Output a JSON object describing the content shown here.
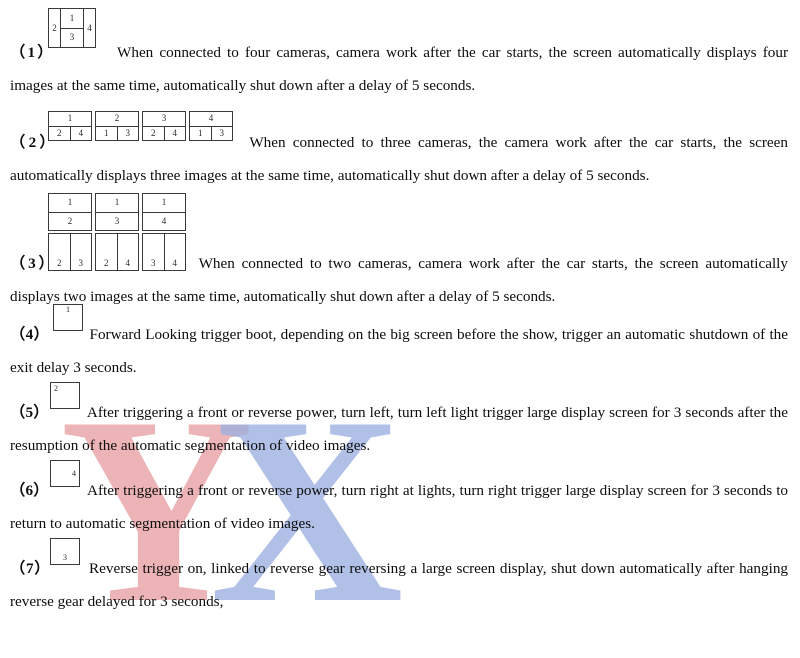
{
  "document": {
    "type": "manual-page",
    "watermark": {
      "letters": [
        "Y",
        "X"
      ],
      "colors": [
        "#e8a0a4",
        "#9cafe0"
      ]
    }
  },
  "items": [
    {
      "marker": "（1）",
      "text": "When connected to four cameras, camera work after the car starts, the screen automatically displays four images at the same time, automatically shut down after a delay of 5 seconds.",
      "diagram": {
        "kind": "quad-split",
        "left": "2",
        "center_top": "1",
        "center_bottom": "3",
        "right": "4"
      }
    },
    {
      "marker": "（2）",
      "text": "When connected to three cameras, the camera work after the car starts, the screen automatically displays three images at the same time, automatically shut down after a delay of 5 seconds.",
      "diagram": {
        "kind": "top-one-bottom-two",
        "boxes": [
          {
            "top": "1",
            "bottom_left": "2",
            "bottom_right": "4"
          },
          {
            "top": "2",
            "bottom_left": "1",
            "bottom_right": "3"
          },
          {
            "top": "3",
            "bottom_left": "2",
            "bottom_right": "4"
          },
          {
            "top": "4",
            "bottom_left": "1",
            "bottom_right": "3"
          }
        ]
      }
    },
    {
      "marker": "（3）",
      "text": "When connected to two cameras, camera work after the car starts, the screen automatically displays two images at the same time, automatically shut down after a delay of 5 seconds.",
      "diagram": {
        "kind": "two-row-pairs",
        "upper": [
          {
            "top": "1",
            "bottom": "2"
          },
          {
            "top": "1",
            "bottom": "3"
          },
          {
            "top": "1",
            "bottom": "4"
          }
        ],
        "lower": [
          {
            "left": "2",
            "right": "3"
          },
          {
            "left": "2",
            "right": "4"
          },
          {
            "left": "3",
            "right": "4"
          }
        ]
      }
    },
    {
      "marker": "（4）",
      "text": "Forward Looking trigger boot, depending on the big screen before the show, trigger an automatic shutdown of the exit delay 3 seconds.",
      "diagram": {
        "kind": "single-box",
        "value": "1",
        "position": "top-center"
      }
    },
    {
      "marker": "（5）",
      "text": "After triggering a front or reverse power, turn left, turn left light trigger large display screen for 3 seconds after the resumption of the automatic segmentation of video images.",
      "diagram": {
        "kind": "single-box",
        "value": "2",
        "position": "top-left"
      }
    },
    {
      "marker": "（6）",
      "text": "After triggering a front or reverse power, turn right at lights, turn right trigger large display screen for 3 seconds to return to automatic segmentation of video images.",
      "diagram": {
        "kind": "single-box",
        "value": "4",
        "position": "middle-right"
      }
    },
    {
      "marker": "（7）",
      "text": "Reverse trigger on, linked to reverse gear reversing a large screen display, shut down automatically after hanging reverse gear delayed for 3 seconds,",
      "diagram": {
        "kind": "single-box",
        "value": "3",
        "position": "bottom-center"
      }
    }
  ]
}
